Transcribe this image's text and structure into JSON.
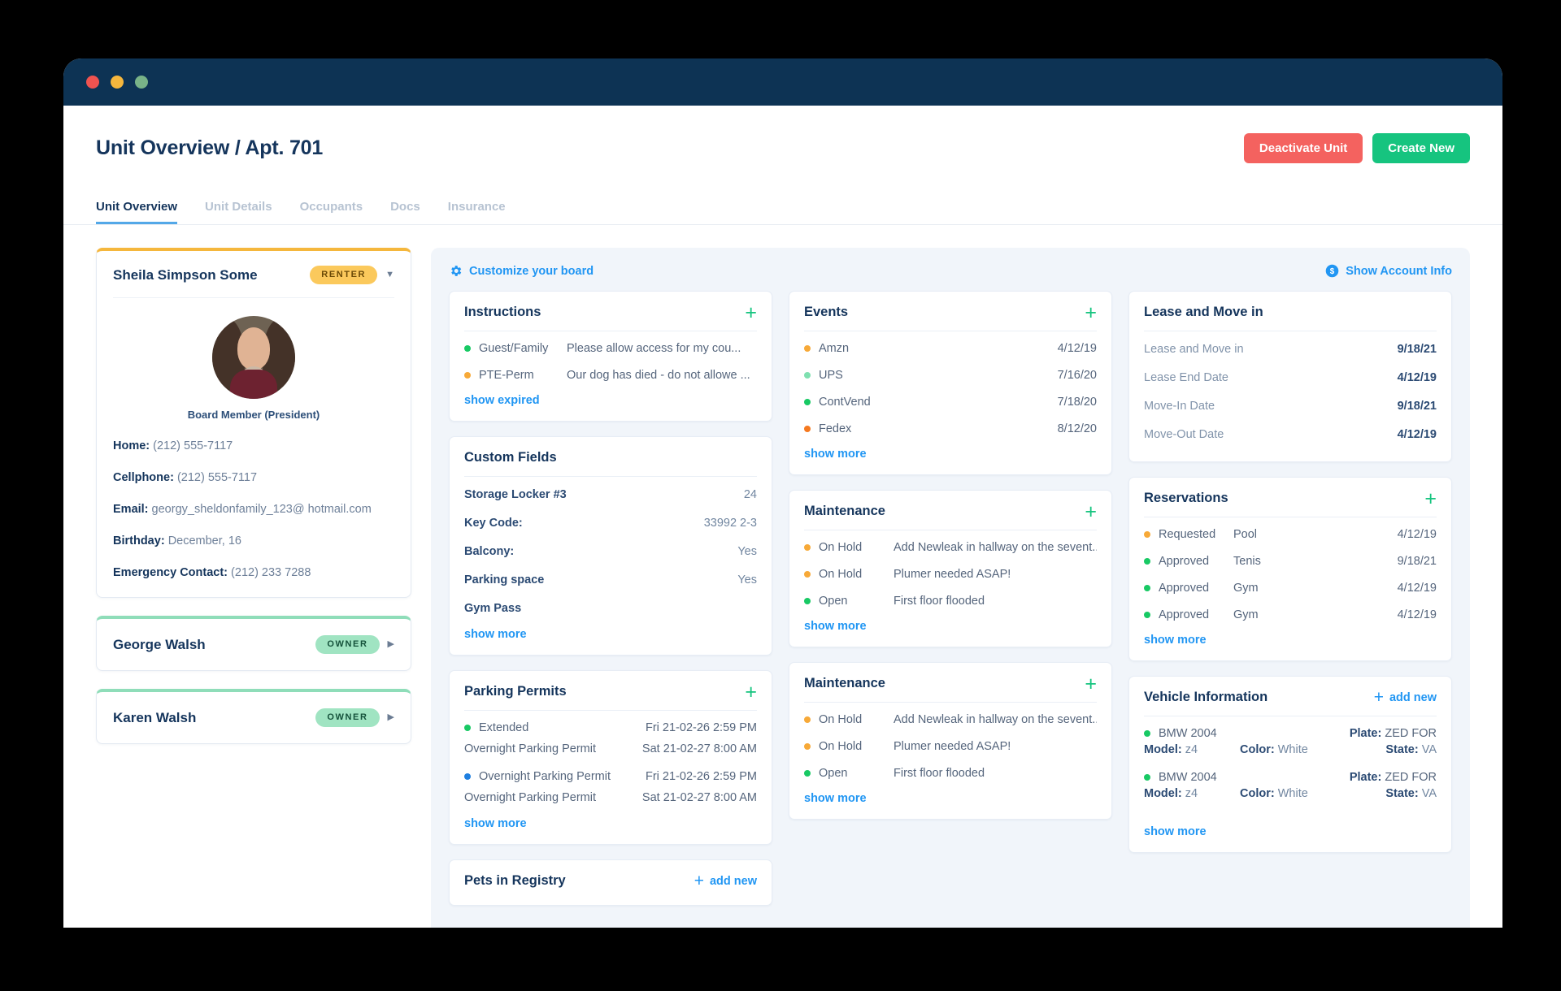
{
  "window": {
    "traffic_lights": [
      "close",
      "minimize",
      "maximize"
    ]
  },
  "header": {
    "title": "Unit Overview / Apt. 701",
    "deactivate_label": "Deactivate Unit",
    "create_label": "Create New"
  },
  "tabs": [
    {
      "label": "Unit Overview",
      "active": true
    },
    {
      "label": "Unit Details",
      "active": false
    },
    {
      "label": "Occupants",
      "active": false
    },
    {
      "label": "Docs",
      "active": false
    },
    {
      "label": "Insurance",
      "active": false
    }
  ],
  "sidebar": {
    "primary": {
      "name": "Sheila Simpson Some",
      "badge": "RENTER",
      "role": "Board Member (President)",
      "fields": [
        {
          "label": "Home:",
          "value": "(212) 555-7117"
        },
        {
          "label": "Cellphone:",
          "value": "(212) 555-7117"
        },
        {
          "label": "Email:",
          "value": "georgy_sheldonfamily_123@ hotmail.com"
        },
        {
          "label": "Birthday:",
          "value": "December, 16"
        },
        {
          "label": "Emergency Contact:",
          "value": "(212) 233 7288"
        }
      ]
    },
    "others": [
      {
        "name": "George Walsh",
        "badge": "OWNER"
      },
      {
        "name": "Karen Walsh",
        "badge": "OWNER"
      }
    ]
  },
  "board": {
    "customize_label": "Customize your board",
    "account_info_label": "Show Account Info",
    "show_more_label": "show more",
    "show_expired_label": "show expired",
    "add_new_label": "add new",
    "column1": {
      "instructions": {
        "title": "Instructions",
        "rows": [
          {
            "dot": "green",
            "label": "Guest/Family",
            "text": "Please allow access for my cou..."
          },
          {
            "dot": "amber",
            "label": "PTE-Perm",
            "text": "Our dog has died - do not allowe ..."
          }
        ],
        "footer": "show expired"
      },
      "custom_fields": {
        "title": "Custom Fields",
        "rows": [
          {
            "key": "Storage Locker #3",
            "value": "24"
          },
          {
            "key": "Key Code:",
            "value": "33992 2-3"
          },
          {
            "key": "Balcony:",
            "value": "Yes"
          },
          {
            "key": "Parking space",
            "value": "Yes"
          },
          {
            "key": "Gym Pass",
            "value": ""
          }
        ],
        "footer": "show more"
      },
      "parking_permits": {
        "title": "Parking Permits",
        "entries": [
          {
            "dot": "green",
            "label": "Extended",
            "date": "Fri 21-02-26 2:59 PM",
            "sub_label": "Overnight Parking Permit",
            "sub_date": "Sat 21-02-27 8:00 AM"
          },
          {
            "dot": "blue",
            "label": "Overnight Parking Permit",
            "date": "Fri 21-02-26 2:59 PM",
            "sub_label": "Overnight Parking Permit",
            "sub_date": "Sat 21-02-27 8:00 AM"
          }
        ],
        "footer": "show more"
      },
      "pets": {
        "title": "Pets in Registry",
        "action": "add new"
      }
    },
    "column2": {
      "events": {
        "title": "Events",
        "rows": [
          {
            "dot": "amber",
            "label": "Amzn",
            "date": "4/12/19"
          },
          {
            "dot": "mint",
            "label": "UPS",
            "date": "7/16/20"
          },
          {
            "dot": "green",
            "label": "ContVend",
            "date": "7/18/20"
          },
          {
            "dot": "orange",
            "label": "Fedex",
            "date": "8/12/20"
          }
        ],
        "footer": "show more"
      },
      "maintenance_1": {
        "title": "Maintenance",
        "rows": [
          {
            "dot": "amber",
            "label": "On Hold",
            "text": "Add Newleak in hallway on the sevent.."
          },
          {
            "dot": "amber",
            "label": "On Hold",
            "text": "Plumer needed ASAP!"
          },
          {
            "dot": "green",
            "label": "Open",
            "text": "First floor flooded"
          }
        ],
        "footer": "show more"
      },
      "maintenance_2": {
        "title": "Maintenance",
        "rows": [
          {
            "dot": "amber",
            "label": "On Hold",
            "text": "Add Newleak in hallway on the sevent.."
          },
          {
            "dot": "amber",
            "label": "On Hold",
            "text": "Plumer needed ASAP!"
          },
          {
            "dot": "green",
            "label": "Open",
            "text": "First floor flooded"
          }
        ],
        "footer": "show more"
      }
    },
    "column3": {
      "lease": {
        "title": "Lease and Move in",
        "rows": [
          {
            "key": "Lease and Move in",
            "value": "9/18/21"
          },
          {
            "key": "Lease End Date",
            "value": "4/12/19"
          },
          {
            "key": "Move-In Date",
            "value": "9/18/21"
          },
          {
            "key": "Move-Out Date",
            "value": "4/12/19"
          }
        ]
      },
      "reservations": {
        "title": "Reservations",
        "rows": [
          {
            "dot": "amber",
            "status": "Requested",
            "place": "Pool",
            "date": "4/12/19"
          },
          {
            "dot": "green",
            "status": "Approved",
            "place": "Tenis",
            "date": "9/18/21"
          },
          {
            "dot": "green",
            "status": "Approved",
            "place": "Gym",
            "date": "4/12/19"
          },
          {
            "dot": "green",
            "status": "Approved",
            "place": "Gym",
            "date": "4/12/19"
          }
        ],
        "footer": "show more"
      },
      "vehicles": {
        "title": "Vehicle Information",
        "action": "add new",
        "rows": [
          {
            "dot": "green",
            "name": "BMW 2004",
            "plate_label": "Plate:",
            "plate": "ZED FOR",
            "model_label": "Model:",
            "model": "z4",
            "color_label": "Color:",
            "color": "White",
            "state_label": "State:",
            "state": "VA"
          },
          {
            "dot": "green",
            "name": "BMW 2004",
            "plate_label": "Plate:",
            "plate": "ZED FOR",
            "model_label": "Model:",
            "model": "z4",
            "color_label": "Color:",
            "color": "White",
            "state_label": "State:",
            "state": "VA"
          }
        ],
        "footer": "show more"
      }
    }
  },
  "colors": {
    "titlebar": "#0d3354",
    "navy": "#15355c",
    "link_blue": "#2196f3",
    "accent_blue": "#53a8e8",
    "green": "#16c47f",
    "danger": "#f4625f",
    "renter_badge": "#fbc95c",
    "owner_badge": "#a0e4c2",
    "board_bg": "#f1f5fa"
  }
}
